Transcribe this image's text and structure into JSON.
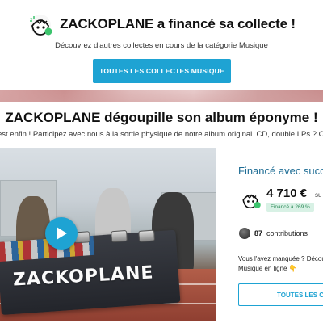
{
  "banner": {
    "title": "ZACKOPLANE a financé sa collecte !",
    "logo_icon": "zackoplane-egg-logo",
    "discover_text": "Découvrez d'autres collectes en cours de la catégorie Musique",
    "collects_button": "TOUTES LES COLLECTES MUSIQUE"
  },
  "project": {
    "title": "ZACKOPLANE dégoupille son album éponyme !",
    "subtitle": "est enfin ! Participez avec nous à la sortie physique de notre album original. CD, double LPs ? C'est"
  },
  "media": {
    "brand_text": "ZACKOPLANE",
    "play_icon": "play-icon"
  },
  "sidebar": {
    "funded_label": "Financé avec succ",
    "amount": "4 710 €",
    "amount_suffix": "su",
    "funded_badge": "Financé à 269 %",
    "funded_percent": 269,
    "contributions_count": "87",
    "contributions_label": "contributions",
    "missed_line1": "Vous l'avez manquée ? Décou",
    "missed_line2": "Musique en ligne 👇",
    "collects_button": "TOUTES LES CO"
  },
  "colors": {
    "accent": "#1ea3d3",
    "funded_text": "#1d6c94",
    "badge_bg": "#d8f1e5",
    "badge_text": "#2c8a57"
  }
}
